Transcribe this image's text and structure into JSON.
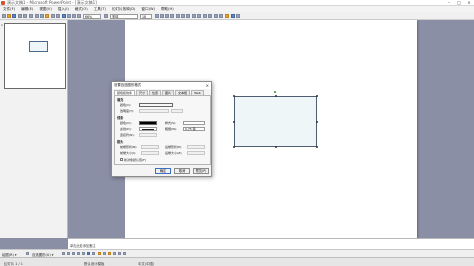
{
  "window": {
    "title": "演示文稿1 - Microsoft PowerPoint - [演示文稿1]",
    "minimize": "–",
    "maximize": "□",
    "close": "×"
  },
  "menu": [
    "文件(F)",
    "编辑(E)",
    "视图(V)",
    "插入(I)",
    "格式(O)",
    "工具(T)",
    "幻灯片放映(D)",
    "窗口(W)",
    "帮助(H)"
  ],
  "toolbar": {
    "font_name": "宋体",
    "font_size": "18",
    "zoom": "66%"
  },
  "outline": {
    "slide_number": "1"
  },
  "notes": {
    "placeholder": "单击此处添加备注"
  },
  "drawbar": {
    "draw_label": "绘图(R) ▾",
    "autoshapes_label": "自选图形(U) ▾"
  },
  "status": {
    "slide": "幻灯片 1 / 1",
    "design": "默认设计模板",
    "language": "中文(中国)"
  },
  "dialog": {
    "title": "设置自选图形格式",
    "close": "×",
    "tabs": [
      "颜色和线条",
      "尺寸",
      "位置",
      "图片",
      "文本框",
      "Web"
    ],
    "active_tab": 0,
    "fill_section": "填充",
    "fill_color_label": "颜色(C):",
    "transparency_label": "透明度(T):",
    "line_section": "线条",
    "line_color_label": "颜色(O):",
    "line_style_label": "样式(S):",
    "dashed_label": "虚线(D):",
    "weight_label": "粗细(W):",
    "weight_value": "0.75 磅",
    "connector_label": "连接符(N):",
    "arrows_section": "箭头",
    "begin_style_label": "前端形状(B):",
    "end_style_label": "后端形状(E):",
    "begin_size_label": "前端大小(I):",
    "end_size_label": "后端大小(Z):",
    "default_checkbox": "新对象默认值(F)",
    "ok": "确定",
    "cancel": "取消",
    "preview": "预览(P)",
    "fill_color": "#ffffff",
    "line_color": "#000000"
  }
}
